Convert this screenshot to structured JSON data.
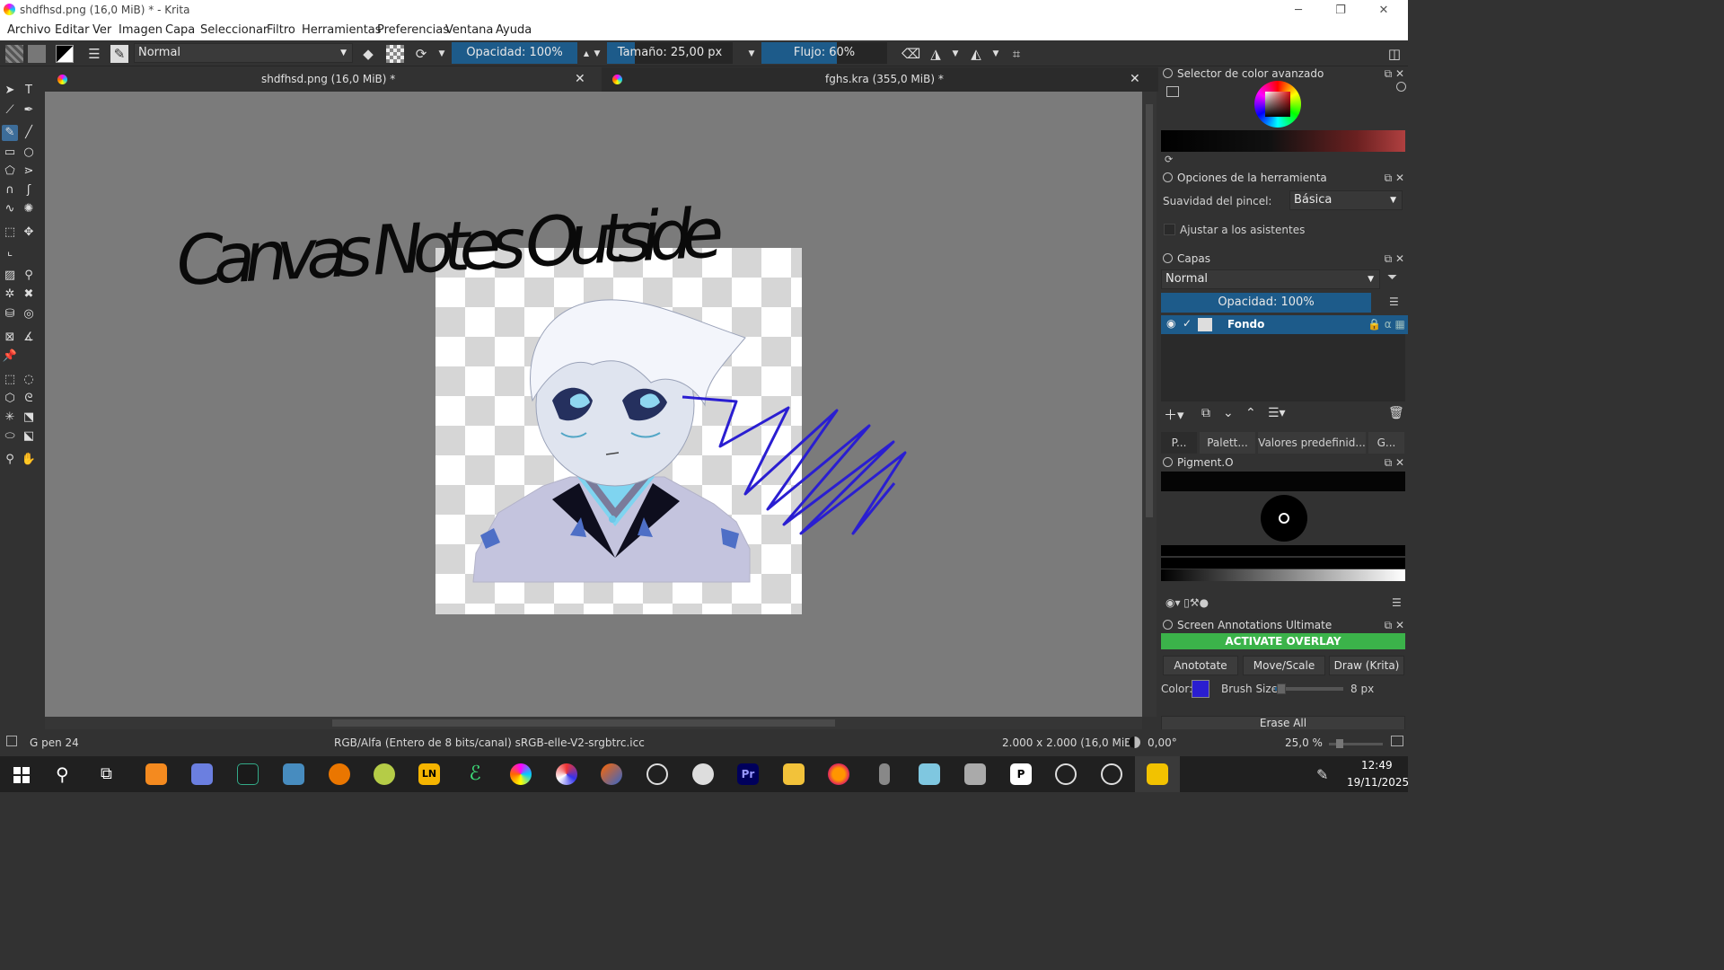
{
  "window": {
    "title": "shdfhsd.png (16,0 MiB) * - Krita"
  },
  "menu": [
    "Archivo",
    "Editar",
    "Ver",
    "Imagen",
    "Capa",
    "Seleccionar",
    "Filtro",
    "Herramientas",
    "Preferencias",
    "Ventana",
    "Ayuda"
  ],
  "toolbar": {
    "blend_mode": "Normal",
    "opacity": "Opacidad: 100%",
    "opacity_fraction": 1.0,
    "size": "Tamaño: 25,00 px",
    "size_fraction": 0.22,
    "flow": "Flujo: 60%",
    "flow_fraction": 0.6
  },
  "tabs": [
    {
      "label": "shdfhsd.png (16,0 MiB) *",
      "close": "✕"
    },
    {
      "label": "fghs.kra (355,0 MiB) *",
      "close": "✕"
    }
  ],
  "canvas": {
    "annotation_text": "Canvas Notes Outside",
    "scribble_color": "#2a1ed1"
  },
  "dockers": {
    "color_selector": {
      "title": "Selector de color avanzado"
    },
    "tool_options": {
      "title": "Opciones de la herramienta",
      "smoothing_label": "Suavidad del pincel:",
      "smoothing_value": "Básica",
      "snap_label": "Ajustar a los asistentes"
    },
    "layers": {
      "title": "Capas",
      "blend_mode": "Normal",
      "opacity": "Opacidad:  100%",
      "layer_name": "Fondo"
    },
    "tabs": [
      "P...",
      "Palett...",
      "Valores predefinid...",
      "G..."
    ],
    "pigment": {
      "title": "Pigment.O"
    },
    "annotations": {
      "title": "Screen Annotations Ultimate",
      "activate": "ACTIVATE OVERLAY",
      "buttons": [
        "Anototate",
        "Move/Scale",
        "Draw (Krita)"
      ],
      "color_label": "Color:",
      "color": "#2a1ed1",
      "brush_size_label": "Brush Size:",
      "brush_size_value": "8 px",
      "brush_size_fraction": 0.08,
      "erase_all": "Erase All"
    }
  },
  "statusbar": {
    "brush": "G pen 24",
    "colorspace": "RGB/Alfa (Entero de 8 bits/canal)  sRGB-elle-V2-srgbtrc.icc",
    "dimensions": "2.000 x 2.000 (16,0 MiB)",
    "rotation": "0,00°",
    "zoom": "25,0 %"
  },
  "taskbar": {
    "time": "12:49",
    "date": "19/11/2025"
  },
  "colors": {
    "accent": "#1d5b8a",
    "activate_green": "#3bb34a",
    "layer_selected": "#1d5b8a"
  }
}
